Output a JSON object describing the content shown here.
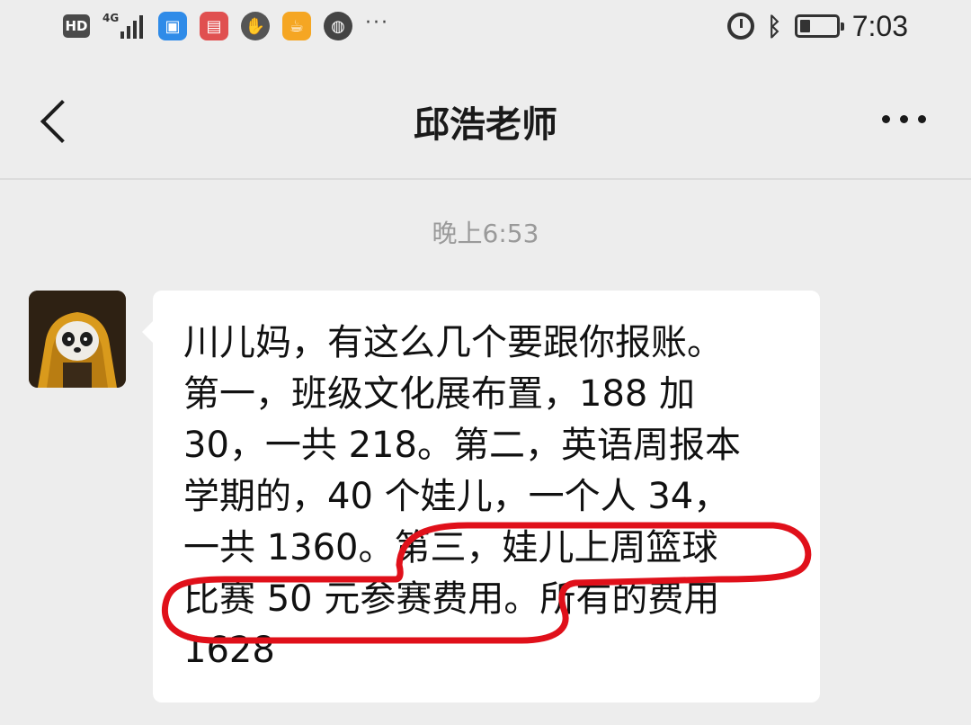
{
  "status_bar": {
    "left_icons": [
      "hd-badge",
      "signal-4g-icon",
      "app-taobao-icon",
      "app-book-icon",
      "app-hand-icon",
      "app-cup-icon",
      "app-globe-icon",
      "more-notifications-icon"
    ],
    "hd_label": "HD",
    "network_label": "4G",
    "right_icons": [
      "alarm-icon",
      "bluetooth-icon",
      "battery-icon"
    ],
    "battery_level": 0.3,
    "time": "7:03"
  },
  "header": {
    "title": "邱浩老师",
    "back_icon": "chevron-left-icon",
    "more_icon": "more-dots-icon"
  },
  "chat": {
    "timestamp": "晚上6:53",
    "message": {
      "sender_avatar": "panda-avatar",
      "lines": [
        "川儿妈，有这么几个要跟你报账。",
        "第一，班级文化展布置，188 加",
        "30，一共 218。第二，英语周报本",
        "学期的，40 个娃儿，一个人 34，",
        "一共 1360。第三，娃儿上周篮球",
        "比赛 50 元参赛费用。所有的费用",
        "1628"
      ],
      "highlight_color": "#e0101a"
    }
  }
}
